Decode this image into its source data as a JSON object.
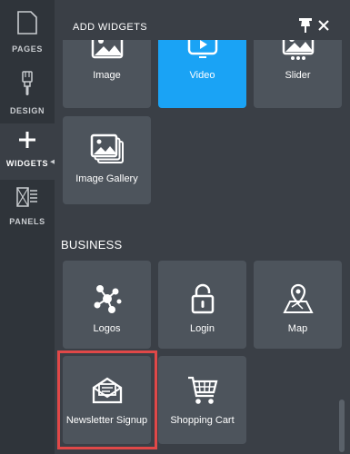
{
  "rail": {
    "items": [
      {
        "label": "PAGES",
        "icon": "page-icon"
      },
      {
        "label": "DESIGN",
        "icon": "brush-icon"
      },
      {
        "label": "WIDGETS",
        "icon": "plus-icon",
        "active": true
      },
      {
        "label": "PANELS",
        "icon": "panels-icon"
      }
    ]
  },
  "panel": {
    "title": "ADD WIDGETS",
    "top_widgets": [
      {
        "label": "Image",
        "icon": "image-icon"
      },
      {
        "label": "Video",
        "icon": "video-icon",
        "selected": true
      },
      {
        "label": "Slider",
        "icon": "slider-icon"
      },
      {
        "label": "Image Gallery",
        "icon": "gallery-icon"
      }
    ],
    "business": {
      "title": "BUSINESS",
      "widgets": [
        {
          "label": "Logos",
          "icon": "logos-icon"
        },
        {
          "label": "Login",
          "icon": "lock-icon"
        },
        {
          "label": "Map",
          "icon": "map-icon"
        },
        {
          "label": "Newsletter Signup",
          "icon": "envelope-icon",
          "highlighted": true
        },
        {
          "label": "Shopping Cart",
          "icon": "cart-icon"
        }
      ]
    }
  },
  "colors": {
    "rail_bg": "#2f343a",
    "panel_bg": "#3a3f46",
    "tile_bg": "#4d545c",
    "selected": "#1aa3f5",
    "highlight": "#e04848"
  }
}
